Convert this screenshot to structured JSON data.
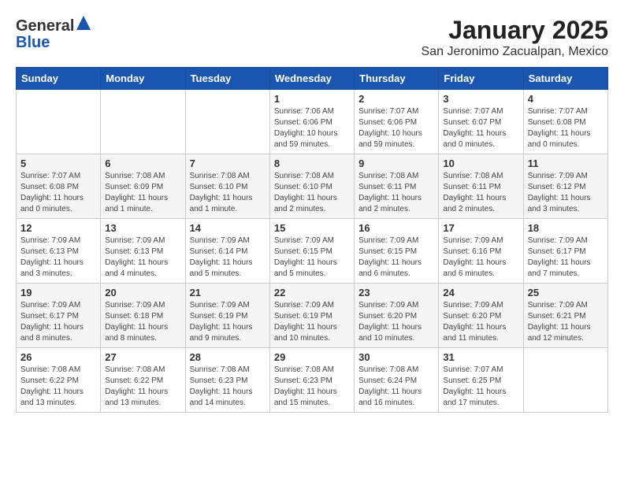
{
  "header": {
    "logo_general": "General",
    "logo_blue": "Blue",
    "title": "January 2025",
    "subtitle": "San Jeronimo Zacualpan, Mexico"
  },
  "weekdays": [
    "Sunday",
    "Monday",
    "Tuesday",
    "Wednesday",
    "Thursday",
    "Friday",
    "Saturday"
  ],
  "weeks": [
    [
      {
        "day": "",
        "info": ""
      },
      {
        "day": "",
        "info": ""
      },
      {
        "day": "",
        "info": ""
      },
      {
        "day": "1",
        "info": "Sunrise: 7:06 AM\nSunset: 6:06 PM\nDaylight: 10 hours\nand 59 minutes."
      },
      {
        "day": "2",
        "info": "Sunrise: 7:07 AM\nSunset: 6:06 PM\nDaylight: 10 hours\nand 59 minutes."
      },
      {
        "day": "3",
        "info": "Sunrise: 7:07 AM\nSunset: 6:07 PM\nDaylight: 11 hours\nand 0 minutes."
      },
      {
        "day": "4",
        "info": "Sunrise: 7:07 AM\nSunset: 6:08 PM\nDaylight: 11 hours\nand 0 minutes."
      }
    ],
    [
      {
        "day": "5",
        "info": "Sunrise: 7:07 AM\nSunset: 6:08 PM\nDaylight: 11 hours\nand 0 minutes."
      },
      {
        "day": "6",
        "info": "Sunrise: 7:08 AM\nSunset: 6:09 PM\nDaylight: 11 hours\nand 1 minute."
      },
      {
        "day": "7",
        "info": "Sunrise: 7:08 AM\nSunset: 6:10 PM\nDaylight: 11 hours\nand 1 minute."
      },
      {
        "day": "8",
        "info": "Sunrise: 7:08 AM\nSunset: 6:10 PM\nDaylight: 11 hours\nand 2 minutes."
      },
      {
        "day": "9",
        "info": "Sunrise: 7:08 AM\nSunset: 6:11 PM\nDaylight: 11 hours\nand 2 minutes."
      },
      {
        "day": "10",
        "info": "Sunrise: 7:08 AM\nSunset: 6:11 PM\nDaylight: 11 hours\nand 2 minutes."
      },
      {
        "day": "11",
        "info": "Sunrise: 7:09 AM\nSunset: 6:12 PM\nDaylight: 11 hours\nand 3 minutes."
      }
    ],
    [
      {
        "day": "12",
        "info": "Sunrise: 7:09 AM\nSunset: 6:13 PM\nDaylight: 11 hours\nand 3 minutes."
      },
      {
        "day": "13",
        "info": "Sunrise: 7:09 AM\nSunset: 6:13 PM\nDaylight: 11 hours\nand 4 minutes."
      },
      {
        "day": "14",
        "info": "Sunrise: 7:09 AM\nSunset: 6:14 PM\nDaylight: 11 hours\nand 5 minutes."
      },
      {
        "day": "15",
        "info": "Sunrise: 7:09 AM\nSunset: 6:15 PM\nDaylight: 11 hours\nand 5 minutes."
      },
      {
        "day": "16",
        "info": "Sunrise: 7:09 AM\nSunset: 6:15 PM\nDaylight: 11 hours\nand 6 minutes."
      },
      {
        "day": "17",
        "info": "Sunrise: 7:09 AM\nSunset: 6:16 PM\nDaylight: 11 hours\nand 6 minutes."
      },
      {
        "day": "18",
        "info": "Sunrise: 7:09 AM\nSunset: 6:17 PM\nDaylight: 11 hours\nand 7 minutes."
      }
    ],
    [
      {
        "day": "19",
        "info": "Sunrise: 7:09 AM\nSunset: 6:17 PM\nDaylight: 11 hours\nand 8 minutes."
      },
      {
        "day": "20",
        "info": "Sunrise: 7:09 AM\nSunset: 6:18 PM\nDaylight: 11 hours\nand 8 minutes."
      },
      {
        "day": "21",
        "info": "Sunrise: 7:09 AM\nSunset: 6:19 PM\nDaylight: 11 hours\nand 9 minutes."
      },
      {
        "day": "22",
        "info": "Sunrise: 7:09 AM\nSunset: 6:19 PM\nDaylight: 11 hours\nand 10 minutes."
      },
      {
        "day": "23",
        "info": "Sunrise: 7:09 AM\nSunset: 6:20 PM\nDaylight: 11 hours\nand 10 minutes."
      },
      {
        "day": "24",
        "info": "Sunrise: 7:09 AM\nSunset: 6:20 PM\nDaylight: 11 hours\nand 11 minutes."
      },
      {
        "day": "25",
        "info": "Sunrise: 7:09 AM\nSunset: 6:21 PM\nDaylight: 11 hours\nand 12 minutes."
      }
    ],
    [
      {
        "day": "26",
        "info": "Sunrise: 7:08 AM\nSunset: 6:22 PM\nDaylight: 11 hours\nand 13 minutes."
      },
      {
        "day": "27",
        "info": "Sunrise: 7:08 AM\nSunset: 6:22 PM\nDaylight: 11 hours\nand 13 minutes."
      },
      {
        "day": "28",
        "info": "Sunrise: 7:08 AM\nSunset: 6:23 PM\nDaylight: 11 hours\nand 14 minutes."
      },
      {
        "day": "29",
        "info": "Sunrise: 7:08 AM\nSunset: 6:23 PM\nDaylight: 11 hours\nand 15 minutes."
      },
      {
        "day": "30",
        "info": "Sunrise: 7:08 AM\nSunset: 6:24 PM\nDaylight: 11 hours\nand 16 minutes."
      },
      {
        "day": "31",
        "info": "Sunrise: 7:07 AM\nSunset: 6:25 PM\nDaylight: 11 hours\nand 17 minutes."
      },
      {
        "day": "",
        "info": ""
      }
    ]
  ]
}
